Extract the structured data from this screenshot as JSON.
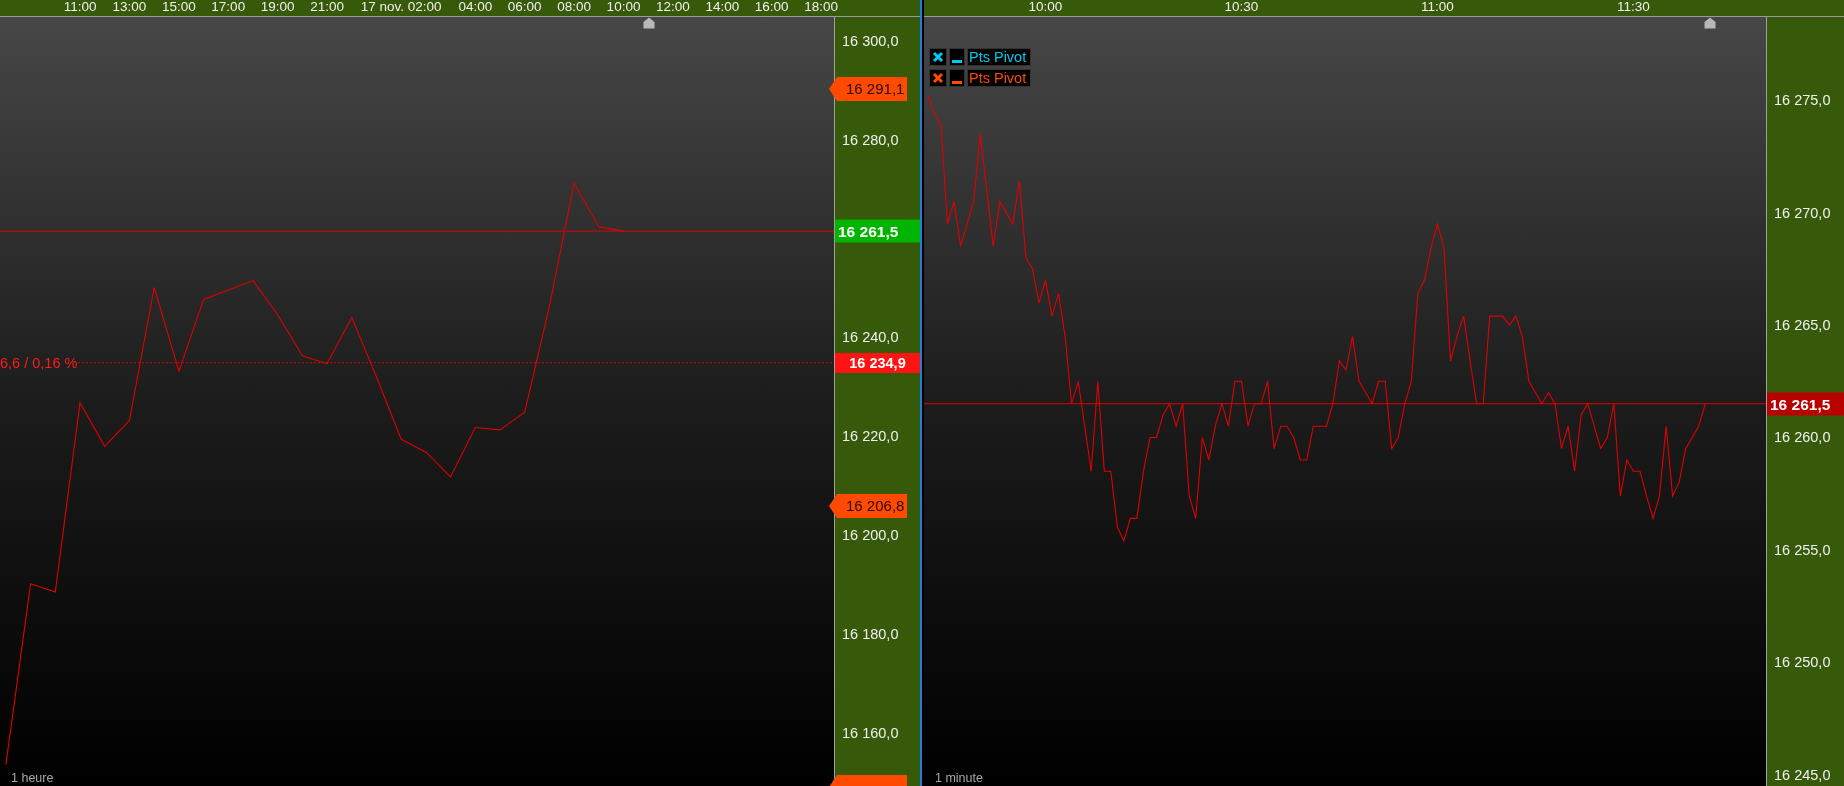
{
  "panels": [
    {
      "interval": "1 heure",
      "percent_note": "6,6 / 0,16 %",
      "price_tags": [
        {
          "kind": "alert",
          "label": "16 291,1",
          "color": "#ff4a00"
        },
        {
          "kind": "last",
          "label": "16 261,5",
          "color": "#00b400"
        },
        {
          "kind": "reference",
          "label": "16 234,9",
          "color": "#ff1414"
        },
        {
          "kind": "alert",
          "label": "16 206,8",
          "color": "#ff4a00"
        },
        {
          "kind": "alert",
          "color": "#ff4a00"
        }
      ],
      "chart_data": {
        "type": "line",
        "categories": [
          null,
          null,
          null,
          "11:00",
          null,
          "13:00",
          null,
          "15:00",
          null,
          "17:00",
          null,
          "19:00",
          null,
          "21:00",
          null,
          null,
          "17 nov. 02:00",
          null,
          null,
          "04:00",
          null,
          "06:00",
          null,
          "08:00",
          null,
          "10:00",
          null,
          "12:00",
          null,
          "14:00",
          null,
          "16:00",
          null,
          "18:00"
        ],
        "series": [
          {
            "color": "#e00000",
            "values": [
              16153.6,
              16190.2,
              16188.5,
              16226.8,
              16218.0,
              16223.2,
              16250.1,
              16233.2,
              16247.7,
              16249.6,
              16251.5,
              16244.6,
              16236.3,
              16234.7,
              16244.1,
              16232.0,
              16219.4,
              16216.8,
              16211.8,
              16221.8,
              16221.3,
              16224.9,
              16246.3,
              16271.2,
              16262.4,
              16261.5,
              null,
              null,
              null,
              null,
              null,
              null,
              null,
              null
            ]
          }
        ],
        "ylim": [
          16149.3,
          16304.8
        ],
        "yticks": [
          {
            "value": 16300,
            "label": "16 300,0"
          },
          {
            "value": 16280,
            "label": "16 280,0"
          },
          {
            "value": 16240,
            "label": "16 240,0"
          },
          {
            "value": 16220,
            "label": "16 220,0"
          },
          {
            "value": 16200,
            "label": "16 200,0"
          },
          {
            "value": 16180,
            "label": "16 180,0"
          },
          {
            "value": 16160,
            "label": "16 160,0"
          }
        ],
        "ref_lines": [
          {
            "axis": "y",
            "value": 16261.5,
            "color": "#e00000"
          },
          {
            "axis": "y",
            "value": 16234.9,
            "color": "#e00000"
          }
        ]
      }
    },
    {
      "interval": "1 minute",
      "legend": [
        {
          "label": "Pts Pivot",
          "color": "#00c8f0"
        },
        {
          "label": "Pts Pivot",
          "color": "#ff4a00"
        }
      ],
      "price_tags": [
        {
          "kind": "last",
          "label": "16 261,5",
          "color": "#b80000"
        }
      ],
      "chart_data": {
        "type": "line",
        "categories": [
          null,
          null,
          null,
          null,
          null,
          null,
          null,
          null,
          null,
          null,
          null,
          null,
          null,
          null,
          null,
          null,
          null,
          null,
          "10:00",
          null,
          null,
          null,
          null,
          null,
          null,
          null,
          null,
          null,
          null,
          null,
          null,
          null,
          null,
          null,
          null,
          null,
          null,
          null,
          null,
          null,
          null,
          null,
          null,
          null,
          null,
          null,
          null,
          null,
          "10:30",
          null,
          null,
          null,
          null,
          null,
          null,
          null,
          null,
          null,
          null,
          null,
          null,
          null,
          null,
          null,
          null,
          null,
          null,
          null,
          null,
          null,
          null,
          null,
          null,
          null,
          null,
          null,
          null,
          null,
          "11:00",
          null,
          null,
          null,
          null,
          null,
          null,
          null,
          null,
          null,
          null,
          null,
          null,
          null,
          null,
          null,
          null,
          null,
          null,
          null,
          null,
          null,
          null,
          null,
          null,
          null,
          null,
          null,
          null,
          null,
          "11:30",
          null,
          null,
          null,
          null,
          null,
          null,
          null,
          null,
          null,
          null,
          null
        ],
        "series": [
          {
            "color": "#e00000",
            "values": [
              16275.2,
              16274.4,
              16273.9,
              16269.5,
              16270.5,
              16268.5,
              16269.5,
              16270.5,
              16273.5,
              16271.0,
              16268.5,
              16270.5,
              16270.0,
              16269.5,
              16271.4,
              16268.0,
              16267.5,
              16266.0,
              16267.0,
              16265.4,
              16266.4,
              16264.5,
              16261.5,
              16262.5,
              16260.5,
              16258.5,
              16262.5,
              16258.5,
              16258.5,
              16256.0,
              16255.4,
              16256.4,
              16256.4,
              16258.5,
              16260.0,
              16260.0,
              16261.0,
              16261.5,
              16260.5,
              16261.5,
              16257.4,
              16256.4,
              16260.0,
              16259.0,
              16260.5,
              16261.5,
              16260.5,
              16262.5,
              16262.5,
              16260.5,
              16261.5,
              16261.5,
              16262.5,
              16259.5,
              16260.5,
              16260.5,
              16260.0,
              16259.0,
              16259.0,
              16260.5,
              16260.5,
              16260.5,
              16261.5,
              16263.4,
              16263.0,
              16264.5,
              16262.5,
              16262.0,
              16261.5,
              16262.5,
              16262.5,
              16259.5,
              16260.0,
              16261.5,
              16262.5,
              16266.4,
              16267.0,
              16268.4,
              16269.5,
              16268.4,
              16263.4,
              16264.5,
              16265.4,
              16263.4,
              16261.5,
              16261.5,
              16265.4,
              16265.4,
              16265.4,
              16265.0,
              16265.4,
              16264.5,
              16262.5,
              16262.0,
              16261.5,
              16262.0,
              16261.5,
              16259.5,
              16260.5,
              16258.5,
              16261.0,
              16261.5,
              16260.5,
              16259.5,
              16260.0,
              16261.5,
              16257.4,
              16259.0,
              16258.5,
              16258.5,
              16257.4,
              16256.4,
              16257.4,
              16260.5,
              16257.4,
              16258.0,
              16259.5,
              16260.0,
              16260.5,
              16261.5
            ]
          }
        ],
        "ylim": [
          16244.5,
          16278.7
        ],
        "yticks": [
          {
            "value": 16275,
            "label": "16 275,0"
          },
          {
            "value": 16270,
            "label": "16 270,0"
          },
          {
            "value": 16265,
            "label": "16 265,0"
          },
          {
            "value": 16260,
            "label": "16 260,0"
          },
          {
            "value": 16255,
            "label": "16 255,0"
          },
          {
            "value": 16250,
            "label": "16 250,0"
          },
          {
            "value": 16245,
            "label": "16 245,0"
          }
        ],
        "ref_lines": [
          {
            "axis": "y",
            "value": 16261.5,
            "color": "#e00000"
          }
        ]
      }
    }
  ]
}
